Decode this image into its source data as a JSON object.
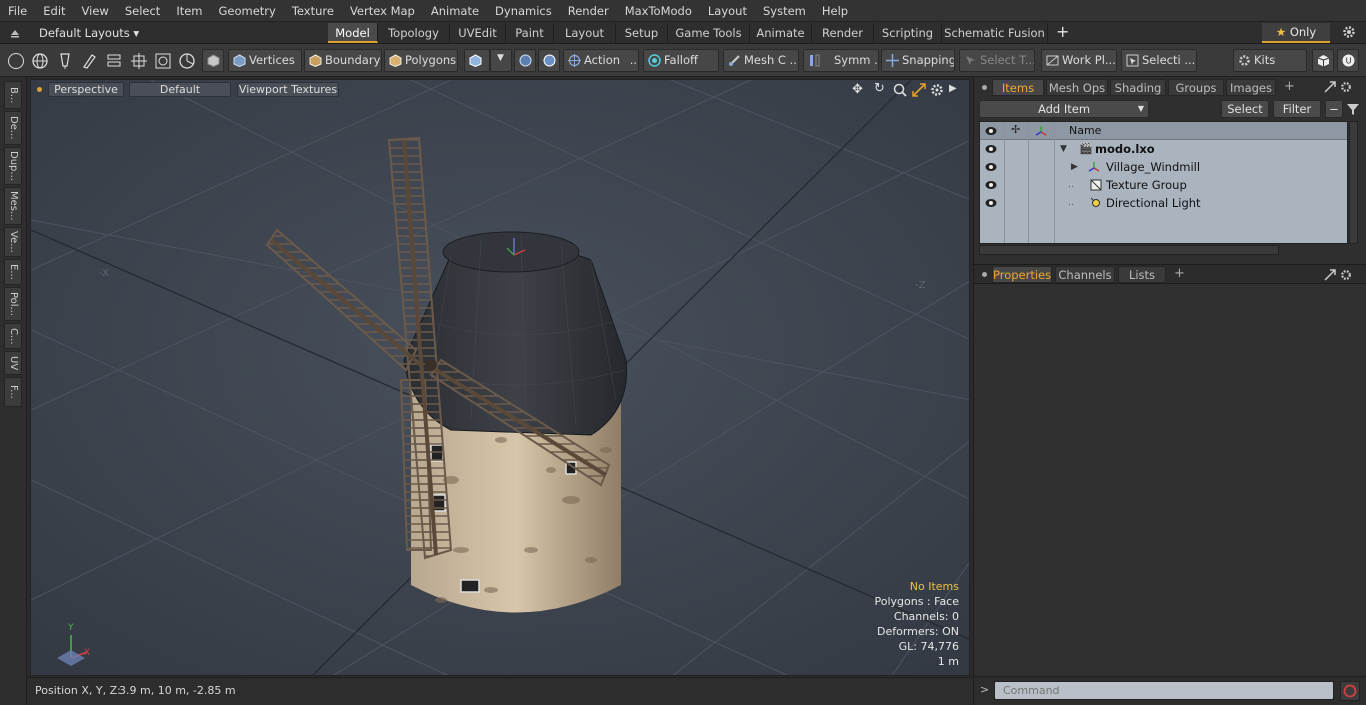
{
  "menu": [
    "File",
    "Edit",
    "View",
    "Select",
    "Item",
    "Geometry",
    "Texture",
    "Vertex Map",
    "Animate",
    "Dynamics",
    "Render",
    "MaxToModo",
    "Layout",
    "System",
    "Help"
  ],
  "layout_selector": "Default Layouts ▾",
  "layout_tabs": [
    "Model",
    "Topology",
    "UVEdit",
    "Paint",
    "Layout",
    "Setup",
    "Game Tools",
    "Animate",
    "Render",
    "Scripting",
    "Schematic Fusion"
  ],
  "active_layout_tab": "Model",
  "add_tab_label": "+",
  "only_label": "Only",
  "toolbar": {
    "vertices": "Vertices",
    "boundary": "Boundary",
    "polygons": "Polygons",
    "action": "Action",
    "action_more": "...",
    "falloff": "Falloff",
    "mesh_c": "Mesh C ...",
    "symm": "Symm ...",
    "snapping": "Snapping",
    "select_t": "Select T...",
    "work_pl": "Work Pl...",
    "selecti": "Selecti ...",
    "kits": "Kits"
  },
  "left_tabs": [
    "B...",
    "De...",
    "Dup...",
    "Mes...",
    "Ve...",
    "E...",
    "Pol...",
    "C...",
    "UV",
    "F..."
  ],
  "viewport": {
    "view_mode": "Perspective",
    "shading": "Default",
    "textures": "Viewport Textures",
    "axis_neg_x": "-X",
    "axis_neg_z": "-Z",
    "stats": {
      "no_items": "No Items",
      "polygons": "Polygons : Face",
      "channels": "Channels: 0",
      "deformers": "Deformers: ON",
      "gl": "GL: 74,776",
      "scale": "1 m"
    },
    "gizmo_labels": {
      "y": "Y",
      "x": "X"
    }
  },
  "status": {
    "position_label": "Position X, Y, Z:",
    "position_value": "3.9 m, 10 m, -2.85 m"
  },
  "items_panel": {
    "tabs": [
      "Items",
      "Mesh Ops",
      "Shading",
      "Groups",
      "Images"
    ],
    "active_tab": "Items",
    "add_item": "Add Item",
    "select": "Select",
    "filter": "Filter",
    "name_header": "Name",
    "rows": [
      {
        "label": "modo.lxo",
        "bold": true
      },
      {
        "label": "Village_Windmill",
        "bold": false
      },
      {
        "label": "Texture Group",
        "bold": false
      },
      {
        "label": "Directional Light",
        "bold": false
      }
    ]
  },
  "properties_panel": {
    "tabs": [
      "Properties",
      "Channels",
      "Lists"
    ],
    "active_tab": "Properties"
  },
  "command": {
    "prompt": ">",
    "placeholder": "Command"
  },
  "colors": {
    "accent": "#f0a830",
    "viewport_bg": "#3d4450",
    "list_bg": "#aab4bf"
  }
}
